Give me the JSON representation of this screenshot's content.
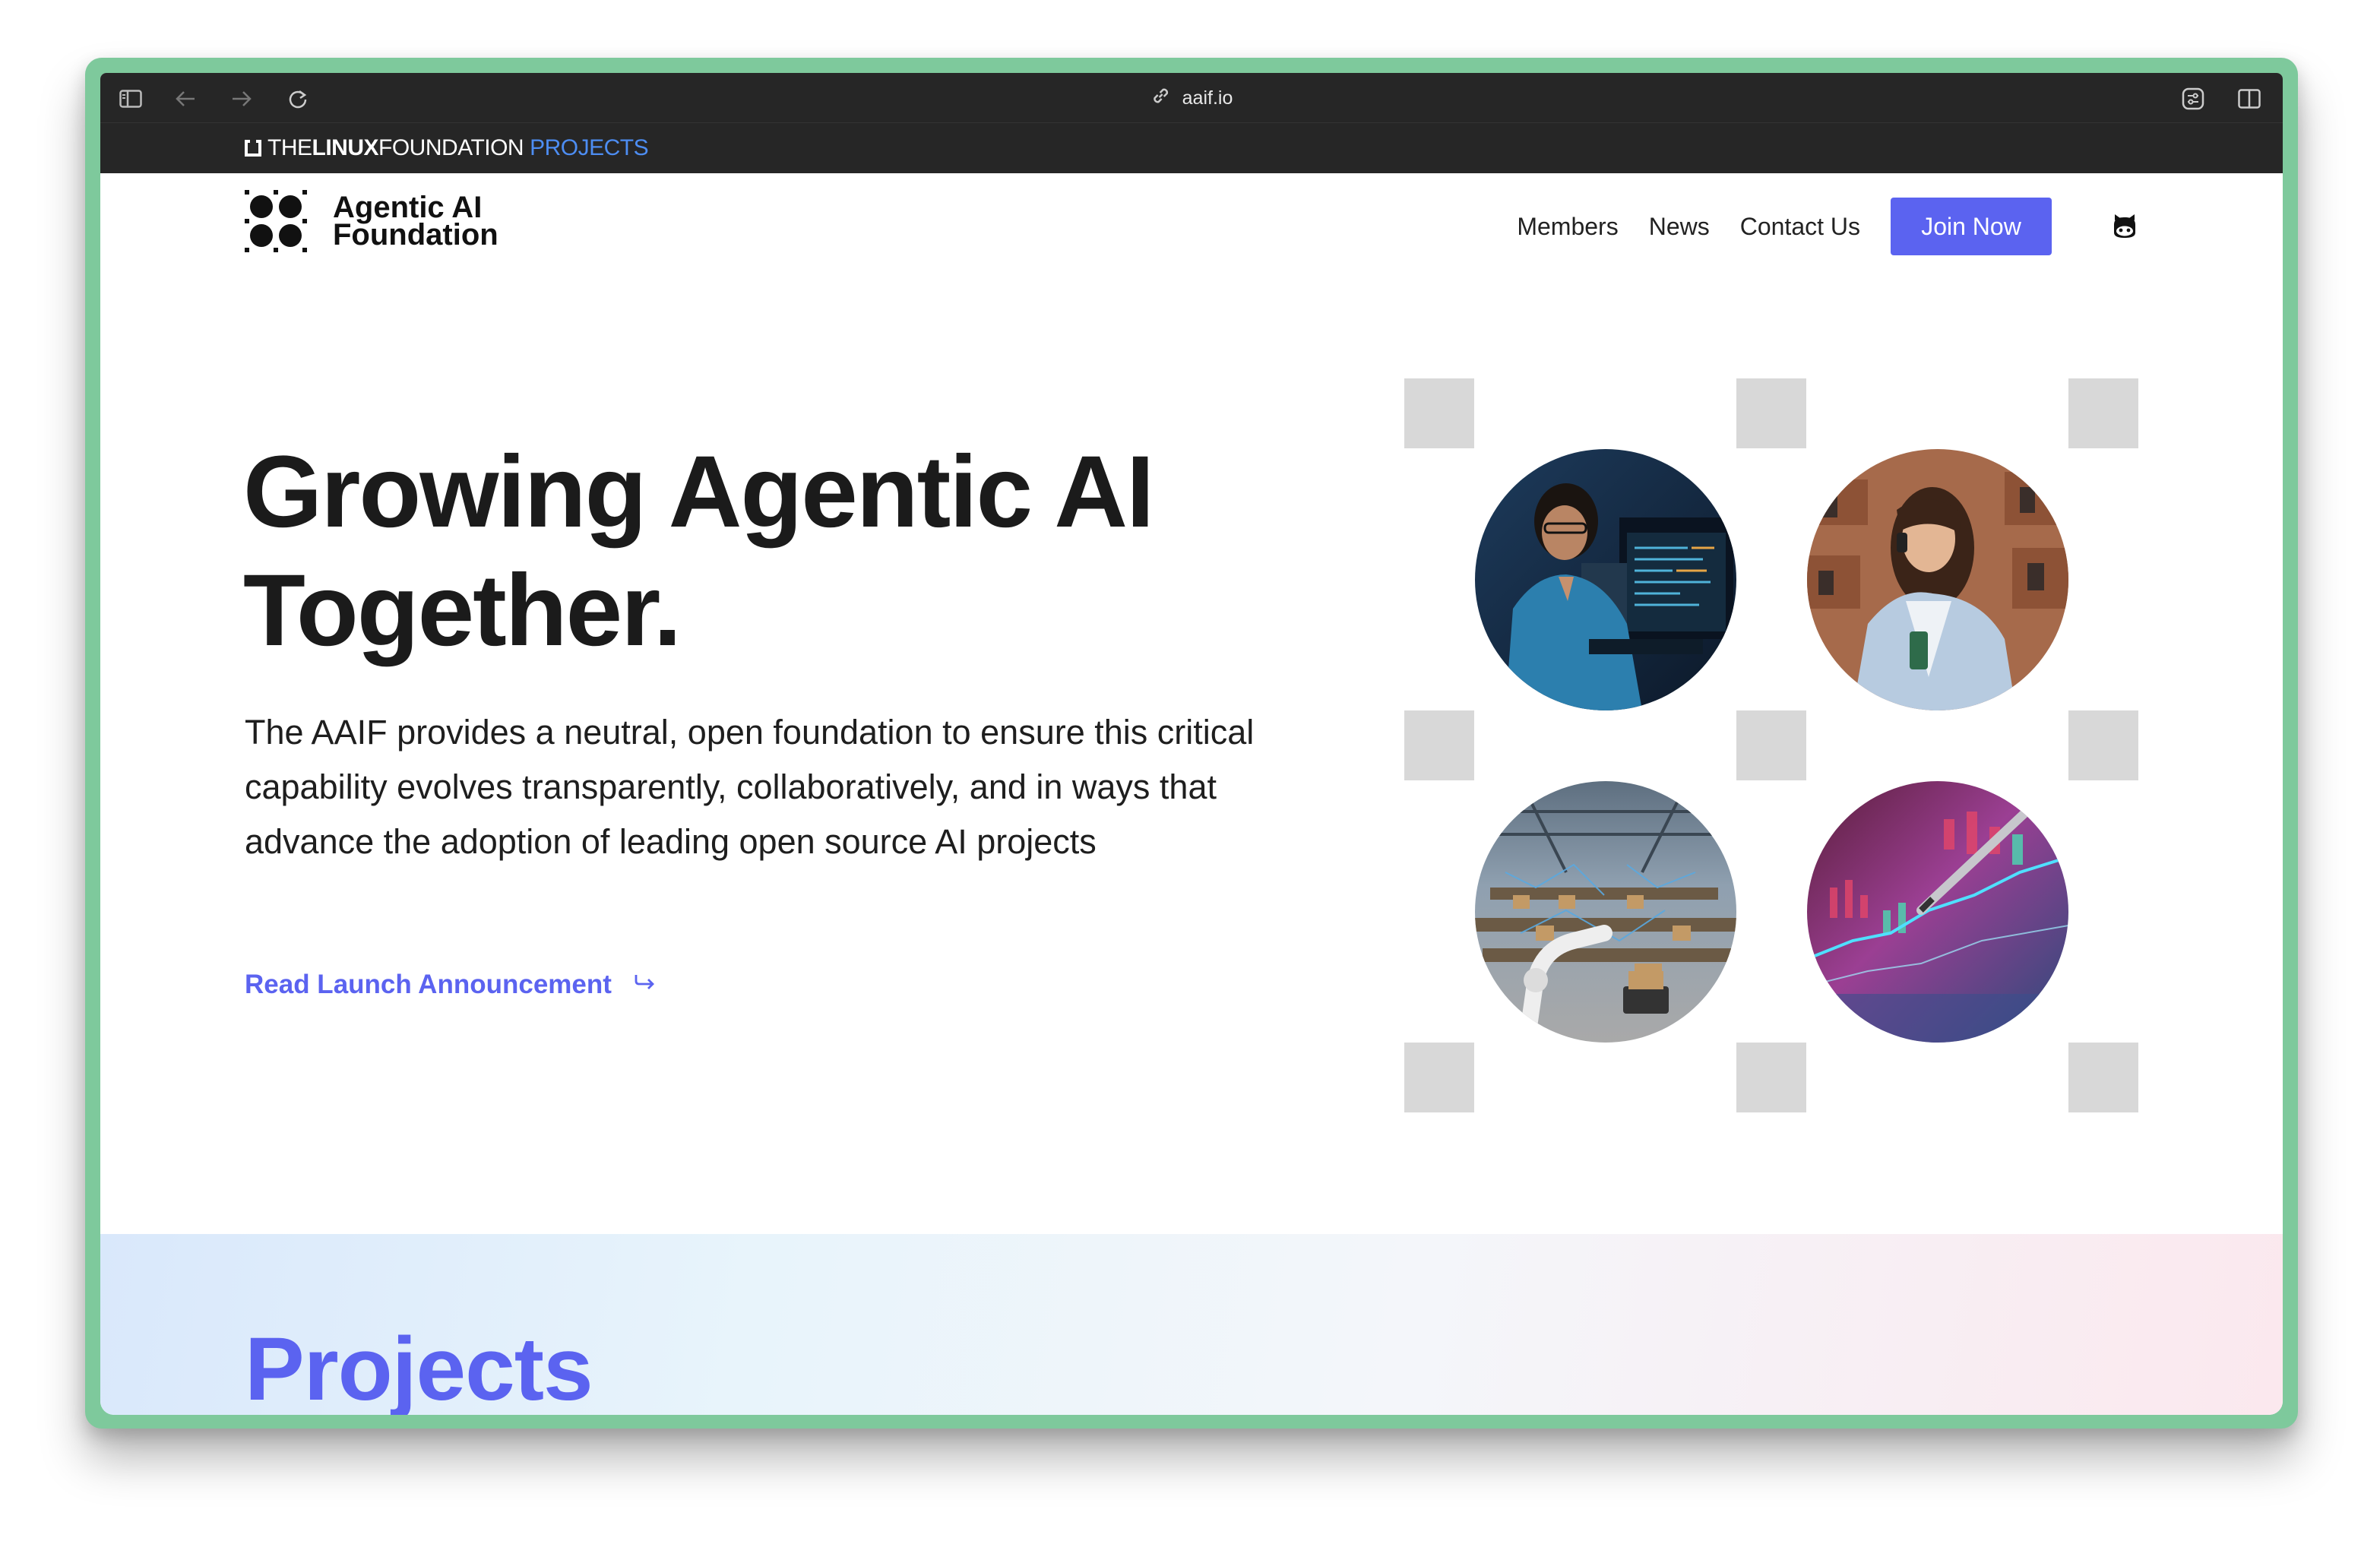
{
  "browser": {
    "url": "aaif.io",
    "icons": [
      "sidebar-icon",
      "back-icon",
      "forward-icon",
      "reload-icon",
      "link-icon",
      "settings-icon",
      "split-view-icon"
    ]
  },
  "lf_bar": {
    "the": "THE",
    "linux": "LINUX",
    "foundation": "FOUNDATION",
    "projects": "PROJECTS"
  },
  "nav": {
    "logo_line1": "Agentic AI",
    "logo_line2": "Foundation",
    "links": [
      "Members",
      "News",
      "Contact Us"
    ],
    "cta": "Join Now",
    "github_icon": "github-icon"
  },
  "hero": {
    "title_line1": "Growing Agentic AI",
    "title_line2": "Together.",
    "description": "The AAIF provides a neutral, open foundation to ensure this critical capability evolves transparently, collaboratively, and in ways that advance the adoption of leading open source AI projects",
    "link": "Read Launch Announcement"
  },
  "images": [
    "woman-at-computer-screens",
    "woman-speaking-into-phone",
    "robotic-arm-warehouse",
    "stylus-on-colorful-chart"
  ],
  "projects": {
    "heading": "Projects"
  },
  "colors": {
    "accent": "#5b63f0",
    "window_border": "#7ec99c",
    "chrome_bg": "#262626",
    "placeholder_square": "#d8d8d8"
  }
}
